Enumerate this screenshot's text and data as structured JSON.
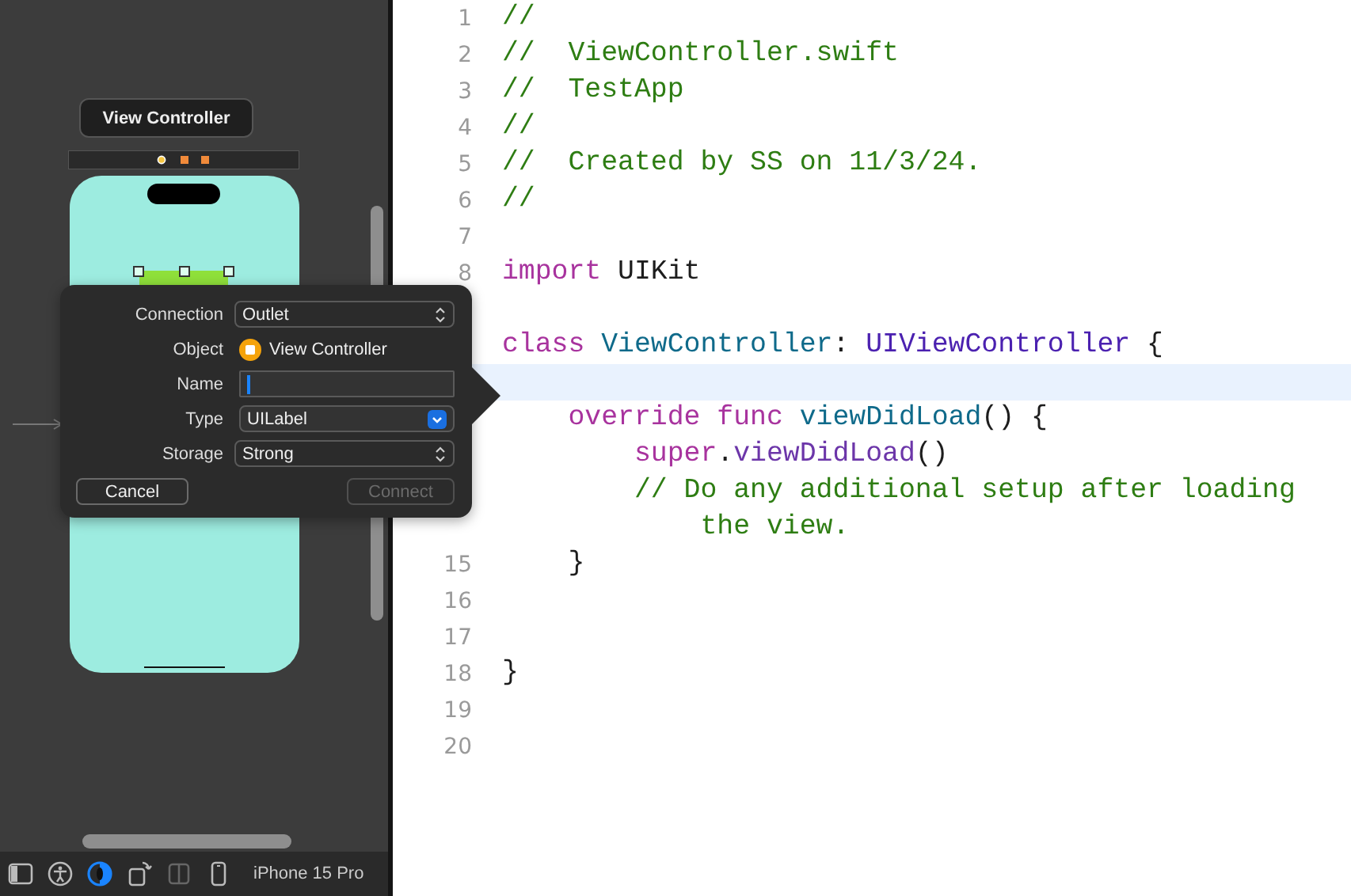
{
  "canvas": {
    "scene_title": "View Controller",
    "appearance_toggle_on": true,
    "device": "iPhone 15 Pro"
  },
  "connection_popover": {
    "fields": [
      {
        "label": "Connection",
        "kind": "popup",
        "value": "Outlet"
      },
      {
        "label": "Object",
        "kind": "object",
        "value": "View Controller"
      },
      {
        "label": "Name",
        "kind": "text",
        "focused": true
      },
      {
        "label": "Type",
        "kind": "combo",
        "value": "UILabel"
      },
      {
        "label": "Storage",
        "kind": "popup",
        "value": "Strong"
      }
    ],
    "buttons": [
      {
        "label": "Cancel",
        "disabled": false
      },
      {
        "label": "Connect",
        "disabled": true
      }
    ]
  },
  "editor": {
    "lines": [
      {
        "number": "1",
        "highlighted": false,
        "tokens": [
          {
            "kind": "comment",
            "text": "//"
          }
        ]
      },
      {
        "number": "2",
        "highlighted": false,
        "tokens": [
          {
            "kind": "comment",
            "text": "//  ViewController.swift"
          }
        ]
      },
      {
        "number": "3",
        "highlighted": false,
        "tokens": [
          {
            "kind": "comment",
            "text": "//  TestApp"
          }
        ]
      },
      {
        "number": "4",
        "highlighted": false,
        "tokens": [
          {
            "kind": "comment",
            "text": "//"
          }
        ]
      },
      {
        "number": "5",
        "highlighted": false,
        "tokens": [
          {
            "kind": "comment",
            "text": "//  Created by SS on 11/3/24."
          }
        ]
      },
      {
        "number": "6",
        "highlighted": false,
        "tokens": [
          {
            "kind": "comment",
            "text": "//"
          }
        ]
      },
      {
        "number": "7",
        "highlighted": false
      },
      {
        "number": "8",
        "highlighted": false,
        "tokens": [
          {
            "kind": "keyword",
            "text": "import"
          },
          {
            "kind": "plain",
            "text": " UIKit"
          }
        ]
      },
      {
        "highlighted": false
      },
      {
        "highlighted": false,
        "tokens": [
          {
            "kind": "keyword",
            "text": "class"
          },
          {
            "kind": "declaration",
            "text": " ViewController"
          },
          {
            "kind": "plain",
            "text": ": "
          },
          {
            "kind": "system_type",
            "text": "UIViewController"
          },
          {
            "kind": "plain",
            "text": " {"
          }
        ]
      },
      {
        "highlighted": true
      },
      {
        "highlighted": false,
        "tokens": [
          {
            "kind": "keyword",
            "text": "    override"
          },
          {
            "kind": "keyword",
            "text": " func"
          },
          {
            "kind": "declaration",
            "text": " viewDidLoad"
          },
          {
            "kind": "plain",
            "text": "() {"
          }
        ]
      },
      {
        "highlighted": false,
        "tokens": [
          {
            "kind": "keyword",
            "text": "        super"
          },
          {
            "kind": "plain",
            "text": "."
          },
          {
            "kind": "system_call",
            "text": "viewDidLoad"
          },
          {
            "kind": "plain",
            "text": "()"
          }
        ]
      },
      {
        "highlighted": false,
        "tokens": [
          {
            "kind": "comment",
            "text": "        // Do any additional setup after loading"
          }
        ]
      },
      {
        "highlighted": false,
        "tokens": [
          {
            "kind": "comment",
            "text": "            the view."
          }
        ]
      },
      {
        "number": "15",
        "highlighted": false,
        "tokens": [
          {
            "kind": "plain",
            "text": "    }"
          }
        ]
      },
      {
        "number": "16",
        "highlighted": false
      },
      {
        "number": "17",
        "highlighted": false
      },
      {
        "number": "18",
        "highlighted": false,
        "tokens": [
          {
            "kind": "plain",
            "text": "}"
          }
        ]
      },
      {
        "number": "19",
        "highlighted": false
      },
      {
        "number": "20",
        "highlighted": false
      }
    ]
  }
}
